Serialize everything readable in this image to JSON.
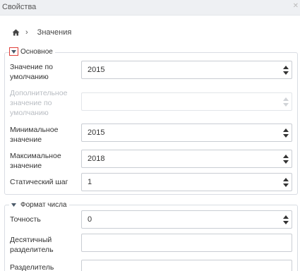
{
  "window": {
    "title": "Свойства"
  },
  "breadcrumb": {
    "current": "Значения"
  },
  "section_basic": {
    "title": "Основное",
    "default_value": {
      "label_line1": "Значение по",
      "label_line2": "умолчанию",
      "value": "2015"
    },
    "additional_default": {
      "label_line1": "Дополнительное",
      "label_line2": "значение по",
      "label_line3": "умолчанию",
      "value": ""
    },
    "min_value": {
      "label_line1": "Минимальное",
      "label_line2": "значение",
      "value": "2015"
    },
    "max_value": {
      "label_line1": "Максимальное",
      "label_line2": "значение",
      "value": "2018"
    },
    "step": {
      "label": "Статический шаг",
      "value": "1"
    }
  },
  "section_number_format": {
    "title": "Формат числа",
    "precision": {
      "label": "Точность",
      "value": "0"
    },
    "decimal_separator": {
      "label_line1": "Десятичный",
      "label_line2": "разделитель",
      "value": ""
    },
    "separator": {
      "label": "Разделитель",
      "value": ""
    }
  },
  "icons": {
    "home": "home-icon",
    "close": "close-icon",
    "collapse": "caret-down-icon",
    "spinner": "spinner-arrows-icon"
  },
  "colors": {
    "highlight_box": "#e0403a",
    "title_bar": "#eef0f3"
  }
}
